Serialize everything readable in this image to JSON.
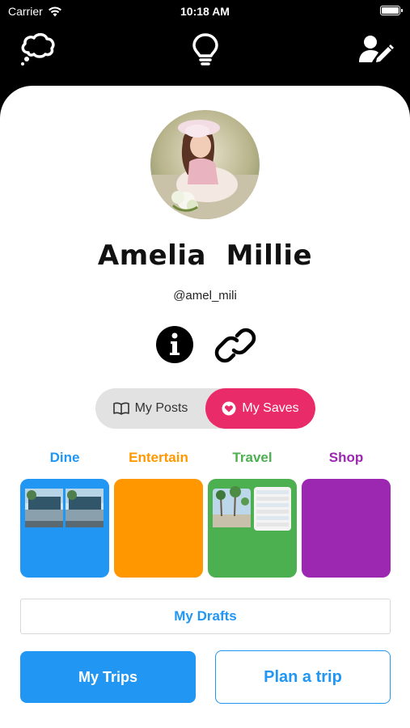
{
  "status_bar": {
    "carrier": "Carrier",
    "time": "10:18 AM",
    "wifi_icon": "wifi-icon",
    "battery_icon": "battery-icon"
  },
  "nav": {
    "left_icon": "thought-cloud-icon",
    "center_icon": "lightbulb-icon",
    "right_icon": "edit-user-icon"
  },
  "profile": {
    "name": "Amelia  Millie",
    "handle": "@amel_mili",
    "avatar_icon": "profile-photo"
  },
  "actions": {
    "info_icon": "info-icon",
    "link_icon": "link-icon"
  },
  "tabs": [
    {
      "label": "My Posts",
      "icon": "book-icon",
      "active": false
    },
    {
      "label": "My Saves",
      "icon": "heart-icon",
      "active": true
    }
  ],
  "categories": [
    {
      "label": "Dine",
      "color": "#2196f3"
    },
    {
      "label": "Entertain",
      "color": "#ff9800"
    },
    {
      "label": "Travel",
      "color": "#4caf50"
    },
    {
      "label": "Shop",
      "color": "#9c27b0"
    }
  ],
  "buttons": {
    "drafts": "My Drafts",
    "trips": "My Trips",
    "plan": "Plan a trip"
  },
  "colors": {
    "accent": "#2196f3",
    "pink": "#ea2b6a"
  }
}
